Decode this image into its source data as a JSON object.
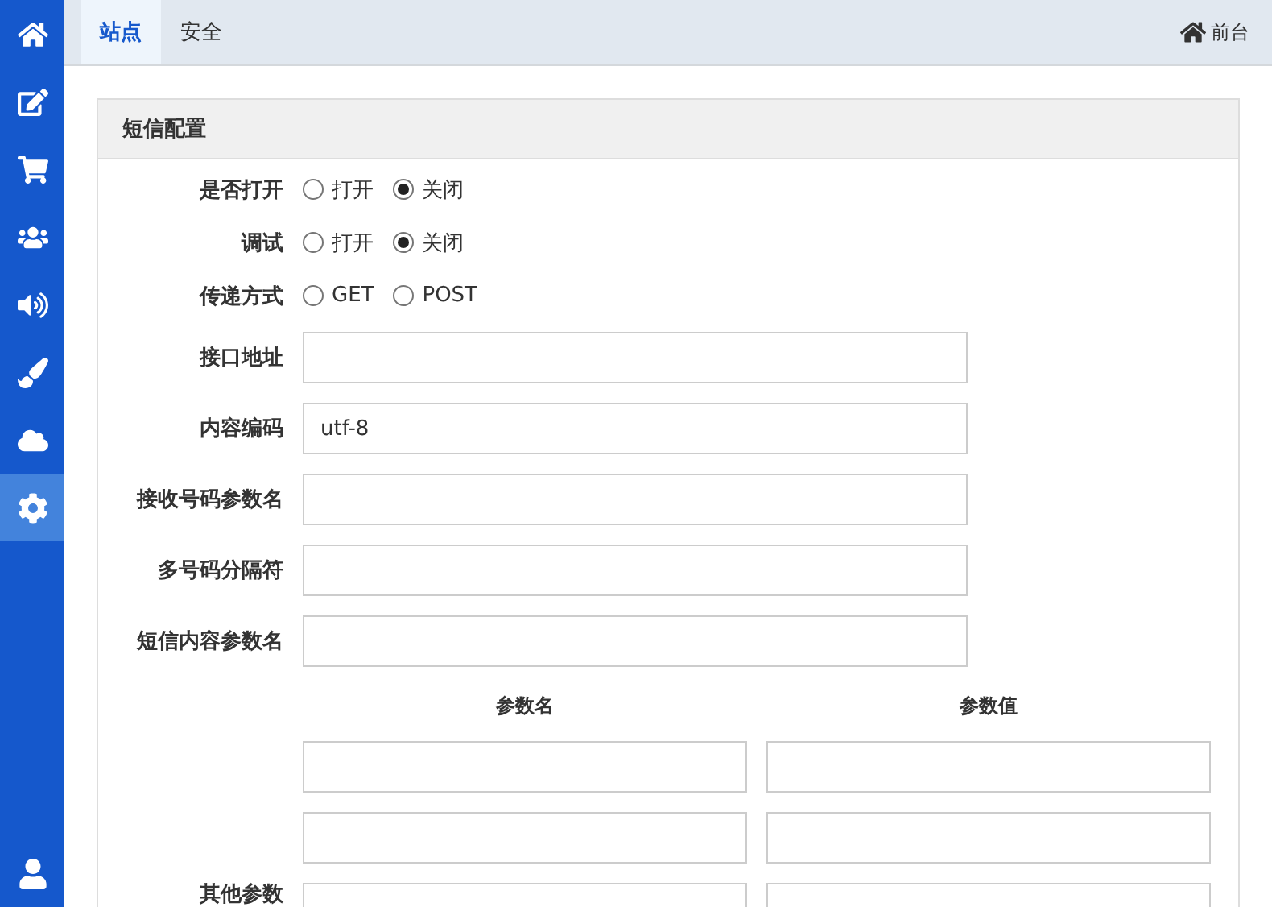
{
  "sidebar": {
    "items": [
      {
        "selected": false
      },
      {
        "selected": false
      },
      {
        "selected": false
      },
      {
        "selected": false
      },
      {
        "selected": false
      },
      {
        "selected": false
      },
      {
        "selected": false
      },
      {
        "selected": true
      }
    ]
  },
  "tabs": [
    {
      "label": "站点",
      "selected": true
    },
    {
      "label": "安全",
      "selected": false
    }
  ],
  "front_link": "前台",
  "panel": {
    "title": "短信配置",
    "fields": [
      {
        "kind": "radio",
        "label": "是否打开",
        "options": [
          {
            "label": "打开",
            "selected": false
          },
          {
            "label": "关闭",
            "selected": true
          }
        ]
      },
      {
        "kind": "radio",
        "label": "调试",
        "options": [
          {
            "label": "打开",
            "selected": false
          },
          {
            "label": "关闭",
            "selected": true
          }
        ]
      },
      {
        "kind": "radio",
        "label": "传递方式",
        "options": [
          {
            "label": "GET",
            "selected": false
          },
          {
            "label": "POST",
            "selected": false
          }
        ]
      },
      {
        "kind": "text",
        "label": "接口地址"
      },
      {
        "kind": "text",
        "label": "内容编码",
        "value": "utf-8"
      },
      {
        "kind": "text",
        "label": "接收号码参数名"
      },
      {
        "kind": "text",
        "label": "多号码分隔符"
      },
      {
        "kind": "text",
        "label": "短信内容参数名"
      }
    ],
    "params": {
      "label": "其他参数",
      "columns": [
        "参数名",
        "参数值"
      ],
      "rows": [
        {
          "kind": "input"
        },
        {
          "kind": "input"
        },
        {
          "kind": "input"
        }
      ]
    }
  }
}
